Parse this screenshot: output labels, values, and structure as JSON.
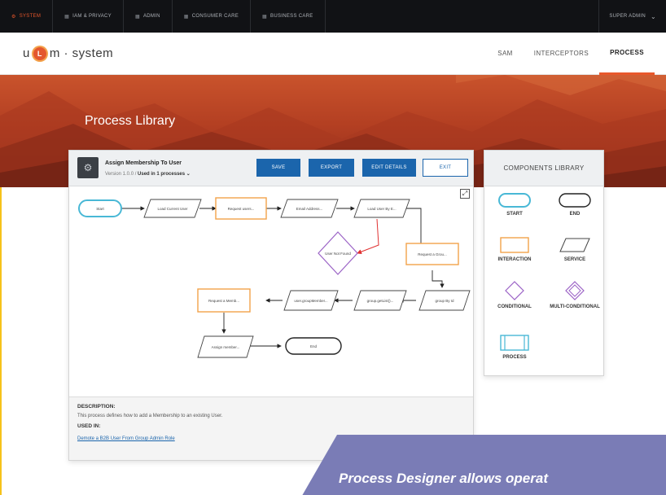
{
  "top_nav": {
    "items": [
      {
        "label": "SYSTEM",
        "icon": "gear-icon",
        "active": true
      },
      {
        "label": "IAM & PRIVACY",
        "icon": "grid-icon",
        "active": false
      },
      {
        "label": "ADMIN",
        "icon": "grid-icon",
        "active": false
      },
      {
        "label": "CONSUMER CARE",
        "icon": "grid-icon",
        "active": false
      },
      {
        "label": "BUSINESS CARE",
        "icon": "grid-icon",
        "active": false
      }
    ],
    "user_menu": "SUPER ADMIN"
  },
  "header": {
    "logo_left": "u",
    "logo_mark": "L",
    "logo_right": "m · system",
    "nav": [
      {
        "label": "SAM",
        "active": false
      },
      {
        "label": "INTERCEPTORS",
        "active": false
      },
      {
        "label": "PROCESS",
        "active": true
      }
    ]
  },
  "hero": {
    "title": "Process Library"
  },
  "process": {
    "name": "Assign Membership To User",
    "version": "Version 1.0.0",
    "separator": "/",
    "used_in": "Used in 1 processes",
    "buttons": {
      "save": "SAVE",
      "export": "EXPORT",
      "edit": "EDIT DETAILS",
      "exit": "EXIT"
    }
  },
  "diagram": {
    "nodes": [
      {
        "id": "start",
        "type": "start",
        "label": "Start"
      },
      {
        "id": "n1",
        "type": "service",
        "label": "Load Current User"
      },
      {
        "id": "n2",
        "type": "interaction",
        "label": "Request users..."
      },
      {
        "id": "n3",
        "type": "service",
        "label": "Email Address..."
      },
      {
        "id": "n4",
        "type": "service",
        "label": "Load User By E..."
      },
      {
        "id": "n5",
        "type": "conditional",
        "label": "User Not Found"
      },
      {
        "id": "n6",
        "type": "interaction",
        "label": "Request a Grou..."
      },
      {
        "id": "n7",
        "type": "service",
        "label": "group By Id"
      },
      {
        "id": "n8",
        "type": "service",
        "label": "group.getList()..."
      },
      {
        "id": "n9",
        "type": "service",
        "label": "user.groupMember..."
      },
      {
        "id": "n10",
        "type": "interaction",
        "label": "Request a Memb..."
      },
      {
        "id": "n11",
        "type": "service",
        "label": "Assign member..."
      },
      {
        "id": "end",
        "type": "end",
        "label": "End"
      }
    ]
  },
  "details": {
    "description_label": "DESCRIPTION:",
    "description": "This process defines how to add a Membership to an existing User.",
    "used_in_label": "USED IN:",
    "used_in_link": "Demote a B2B User From Group Admin Role"
  },
  "components_library": {
    "title": "COMPONENTS LIBRARY",
    "items": [
      {
        "label": "START",
        "shape": "start"
      },
      {
        "label": "END",
        "shape": "end"
      },
      {
        "label": "INTERACTION",
        "shape": "interaction"
      },
      {
        "label": "SERVICE",
        "shape": "service"
      },
      {
        "label": "CONDITIONAL",
        "shape": "conditional"
      },
      {
        "label": "MULTI-CONDITIONAL",
        "shape": "multi-conditional"
      },
      {
        "label": "PROCESS",
        "shape": "process"
      }
    ]
  },
  "banner": {
    "text": "Process Designer allows operat"
  },
  "colors": {
    "accent": "#e8572b",
    "primary_button": "#1b65ac",
    "start_node": "#49b8d6",
    "interaction_node": "#f2a24a",
    "conditional_node": "#9b63c6",
    "false_branch": "#e03131",
    "banner": "#7a7cb6"
  }
}
